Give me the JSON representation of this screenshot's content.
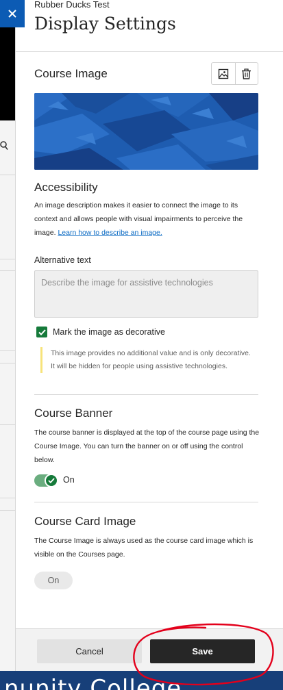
{
  "background": {
    "footer_text": "nunity College"
  },
  "panel": {
    "course_name": "Rubber Ducks Test",
    "title": "Display Settings"
  },
  "course_image": {
    "heading": "Course Image"
  },
  "accessibility": {
    "heading": "Accessibility",
    "description": "An image description makes it easier to connect the image to its context and allows people with visual impairments to perceive the image.",
    "link": "Learn how to describe an image.",
    "alt_label": "Alternative text",
    "alt_placeholder": "Describe the image for assistive technologies",
    "decorative_label": "Mark the image as decorative",
    "decorative_checked": true,
    "decorative_note": "This image provides no additional value and is only decorative. It will be hidden for people using assistive technologies."
  },
  "course_banner": {
    "heading": "Course Banner",
    "description": "The course banner is displayed at the top of the course page using the Course Image. You can turn the banner on or off using the control below.",
    "toggle_label": "On",
    "toggle_on": true
  },
  "course_card": {
    "heading": "Course Card Image",
    "description": "The Course Image is always used as the course card image which is visible on the Courses page.",
    "status_label": "On"
  },
  "footer": {
    "cancel_label": "Cancel",
    "save_label": "Save"
  },
  "colors": {
    "close_button": "#0c5bb4",
    "success_green": "#157a3a",
    "note_accent": "#f7e37a",
    "save_button": "#262626",
    "annotation": "#e3001b"
  },
  "icons": {
    "close": "close-icon",
    "change_image": "image-icon",
    "delete_image": "trash-icon",
    "checkbox": "checkmark-icon"
  }
}
